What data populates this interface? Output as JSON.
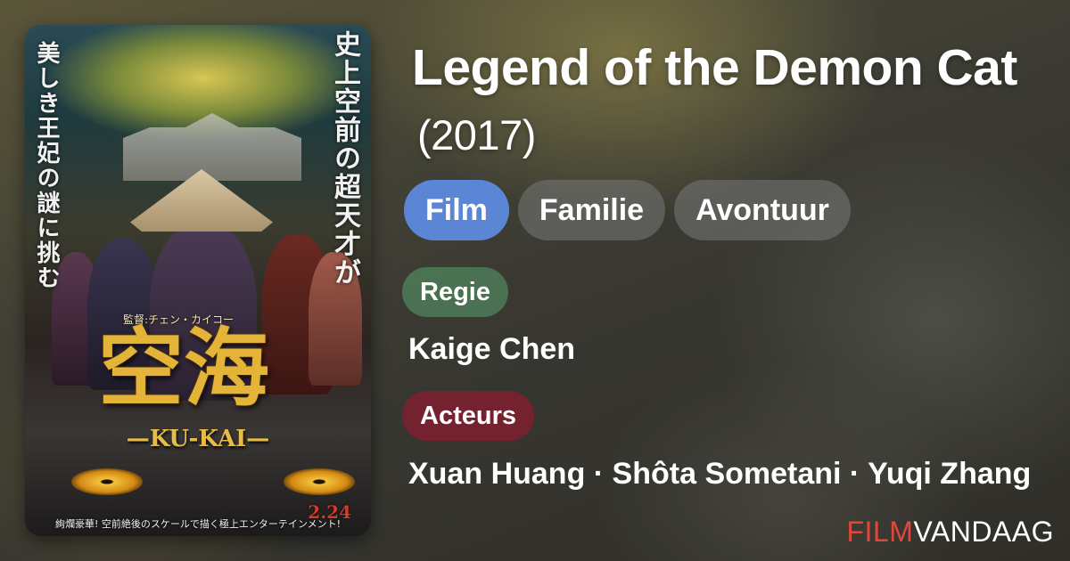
{
  "movie": {
    "title": "Legend of the Demon Cat",
    "year": "(2017)"
  },
  "genres": [
    "Film",
    "Familie",
    "Avontuur"
  ],
  "director": {
    "label": "Regie",
    "name": "Kaige Chen"
  },
  "cast": {
    "label": "Acteurs",
    "names": "Xuan Huang · Shôta Sometani · Yuqi Zhang"
  },
  "poster": {
    "vertical_right": "史上空前の超天才が",
    "vertical_left": "美しき王妃の謎に挑む",
    "director_credit": "監督:チェン・カイコー",
    "title_jp": "空海",
    "title_en": "—KU-KAI—",
    "date": "2.24",
    "tagline": "絢爛豪華! 空前絶後のスケールで描く極上エンターテインメント!"
  },
  "brand": {
    "part1": "FILM",
    "part2": "VANDAAG"
  },
  "colors": {
    "genre_primary": "#5b86d6",
    "genre_default": "#787878",
    "regie_badge": "#4e7c58",
    "acteurs_badge": "#7e2030",
    "brand_red": "#e0473b"
  }
}
